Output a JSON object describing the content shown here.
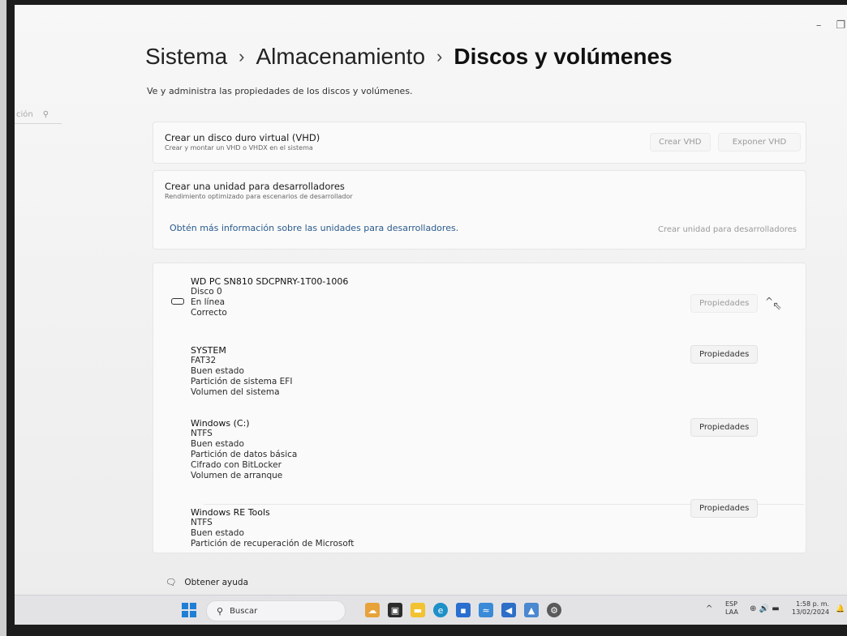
{
  "window": {
    "minimize_icon": "minimize-icon",
    "restore_icon": "restore-icon",
    "minimize": "–",
    "restore": "❐"
  },
  "nav": {
    "search_placeholder": "ción",
    "search_icon": "search-icon"
  },
  "breadcrumb": {
    "items": [
      "Sistema",
      "Almacenamiento",
      "Discos y volúmenes"
    ],
    "separator": "›"
  },
  "page": {
    "subtitle": "Ve y administra las propiedades de los discos y volúmenes."
  },
  "vhd": {
    "title": "Crear un disco duro virtual (VHD)",
    "description": "Crear y montar un VHD o VHDX en el sistema",
    "create_button": "Crear VHD",
    "attach_button": "Exponer VHD"
  },
  "dev_drive": {
    "title": "Crear una unidad para desarrolladores",
    "description": "Rendimiento optimizado para escenarios de desarrollador",
    "learn_more": "Obtén más información sobre las unidades para desarrolladores.",
    "create_button": "Crear unidad para desarrolladores"
  },
  "disk": {
    "icon": "drive-icon",
    "model": "WD PC SN810 SDCPNRY-1T00-1006",
    "number": "Disco 0",
    "state": "En línea",
    "health": "Correcto",
    "properties_button": "Propiedades",
    "chevron": "^"
  },
  "volumes": [
    {
      "name": "SYSTEM",
      "details": [
        "FAT32",
        "Buen estado",
        "Partición de sistema EFI",
        "Volumen del sistema"
      ],
      "properties_button": "Propiedades"
    },
    {
      "name": "Windows  (C:)",
      "details": [
        "NTFS",
        "Buen estado",
        "Partición de datos básica",
        "Cifrado con BitLocker",
        "Volumen de arranque"
      ],
      "properties_button": "Propiedades"
    },
    {
      "name": "Windows RE Tools",
      "details": [
        "NTFS",
        "Buen estado",
        "Partición de recuperación de Microsoft"
      ],
      "properties_button": "Propiedades"
    }
  ],
  "help": {
    "label": "Obtener ayuda",
    "icon": "help-chat-icon"
  },
  "taskbar": {
    "search_placeholder": "Buscar",
    "search_icon": "search-icon",
    "tray_chevron": "^",
    "lang_1": "ESP",
    "lang_2": "LAA",
    "time": "1:58 p. m.",
    "date": "13/02/2024",
    "tray_icons": "⊕ 🔊 ▬",
    "bell": "🔔"
  },
  "colors": {
    "accent": "#1f7fd6",
    "link": "#2a5a8c"
  }
}
